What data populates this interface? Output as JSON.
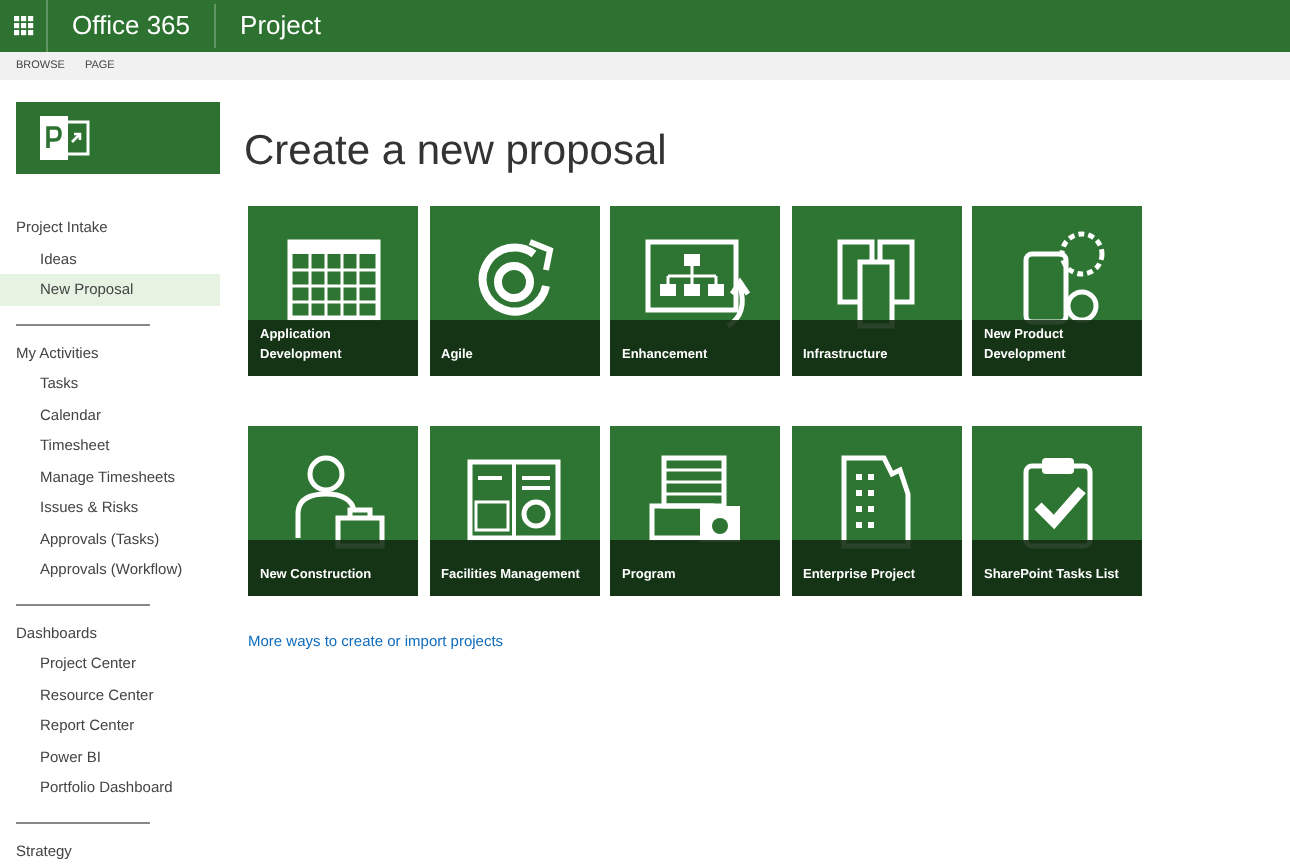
{
  "top_bar": {
    "suite": "Office 365",
    "app": "Project"
  },
  "ribbon": {
    "tabs": [
      "BROWSE",
      "PAGE"
    ]
  },
  "page_title": "Create a new proposal",
  "sidebar": {
    "sections": [
      {
        "heading": "Project Intake",
        "items": [
          {
            "label": "Ideas",
            "selected": false
          },
          {
            "label": "New Proposal",
            "selected": true
          }
        ]
      },
      {
        "heading": "My Activities",
        "items": [
          {
            "label": "Tasks",
            "selected": false
          },
          {
            "label": "Calendar",
            "selected": false
          },
          {
            "label": "Timesheet",
            "selected": false
          },
          {
            "label": "Manage Timesheets",
            "selected": false
          },
          {
            "label": "Issues & Risks",
            "selected": false
          },
          {
            "label": "Approvals (Tasks)",
            "selected": false
          },
          {
            "label": "Approvals (Workflow)",
            "selected": false
          }
        ]
      },
      {
        "heading": "Dashboards",
        "items": [
          {
            "label": "Project Center",
            "selected": false
          },
          {
            "label": "Resource Center",
            "selected": false
          },
          {
            "label": "Report Center",
            "selected": false
          },
          {
            "label": "Power BI",
            "selected": false
          },
          {
            "label": "Portfolio Dashboard",
            "selected": false
          }
        ]
      },
      {
        "heading": "Strategy"
      }
    ]
  },
  "tile_rows": [
    [
      {
        "label": "Application Development"
      },
      {
        "label": "Agile"
      },
      {
        "label": "Enhancement"
      },
      {
        "label": "Infrastructure"
      },
      {
        "label": "New Product Development"
      }
    ],
    [
      {
        "label": "New Construction"
      },
      {
        "label": "Facilities Management"
      },
      {
        "label": "Program"
      },
      {
        "label": "Enterprise Project"
      },
      {
        "label": "SharePoint Tasks List"
      }
    ]
  ],
  "more_link": "More ways to create or import projects"
}
